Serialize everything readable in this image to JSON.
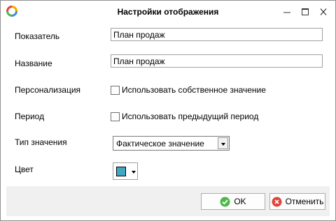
{
  "window": {
    "title": "Настройки отображения"
  },
  "form": {
    "indicator_label": "Показатель",
    "indicator_value": "План продаж",
    "name_label": "Название",
    "name_value": "План продаж",
    "personalization_label": "Персонализация",
    "personalization_checkbox_label": "Использовать собственное значение",
    "personalization_checked": false,
    "period_label": "Период",
    "period_checkbox_label": "Использовать предыдущий период",
    "period_checked": false,
    "value_type_label": "Тип значения",
    "value_type_selected": "Фактическое значение",
    "color_label": "Цвет",
    "color_value": "#3fa9c3"
  },
  "buttons": {
    "ok_label": "OK",
    "cancel_label": "Отменить"
  },
  "colors": {
    "ok_icon": "#4cb848",
    "cancel_icon": "#e0443a"
  }
}
